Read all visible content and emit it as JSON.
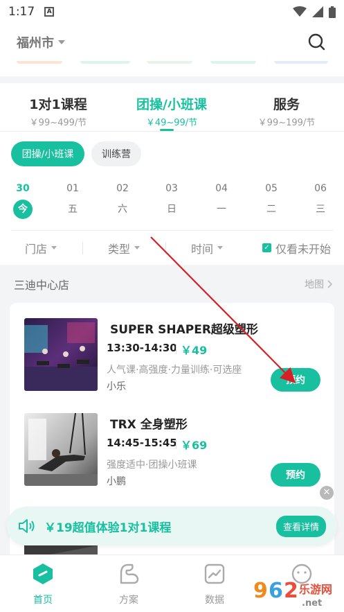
{
  "status_bar": {
    "time": "1:17",
    "notif_icon": "a-notification-icon"
  },
  "header": {
    "city": "福州市"
  },
  "tabs": [
    {
      "title": "1对1课程",
      "price": "￥99~499/节",
      "active": false
    },
    {
      "title": "团操/小班课",
      "price": "￥49~99/节",
      "active": true
    },
    {
      "title": "服务",
      "price": "￥99~199/节",
      "active": false
    }
  ],
  "chips": [
    {
      "label": "团操/小班课",
      "active": true
    },
    {
      "label": "训练营",
      "active": false
    }
  ],
  "dates": [
    {
      "day": "30",
      "weekday": "今",
      "active": true
    },
    {
      "day": "01",
      "weekday": "五",
      "active": false
    },
    {
      "day": "02",
      "weekday": "六",
      "active": false
    },
    {
      "day": "03",
      "weekday": "日",
      "active": false
    },
    {
      "day": "04",
      "weekday": "一",
      "active": false
    },
    {
      "day": "05",
      "weekday": "二",
      "active": false
    },
    {
      "day": "06",
      "weekday": "三",
      "active": false
    }
  ],
  "filters": {
    "store": "门店",
    "type": "类型",
    "time": "时间",
    "only_not_started": "仅看未开始"
  },
  "store": {
    "name": "三迪中心店",
    "map": "地图"
  },
  "courses": [
    {
      "title": "SUPER SHAPER超级塑形",
      "time": "13:30-14:30",
      "price": "￥49",
      "tags": "人气课·高强度·力量训练·可选座",
      "coach": "小乐",
      "book": "预约"
    },
    {
      "title": "TRX 全身塑形",
      "time": "14:45-15:45",
      "price": "￥69",
      "tags": "强度适中·团操小班课",
      "coach": "小鹏",
      "book": "预约"
    }
  ],
  "promo": {
    "text": "￥19超值体验1对1课程",
    "button": "查看详情"
  },
  "bottom_nav": [
    {
      "label": "首页",
      "icon": "home-icon",
      "active": true
    },
    {
      "label": "方案",
      "icon": "muscle-icon",
      "active": false
    },
    {
      "label": "数据",
      "icon": "chart-icon",
      "active": false
    }
  ],
  "watermark": {
    "text": "962",
    "sub": "乐游网",
    "domain": ".net"
  },
  "colors": {
    "accent": "#19c0a0",
    "annotation_arrow": "#d61f26"
  }
}
